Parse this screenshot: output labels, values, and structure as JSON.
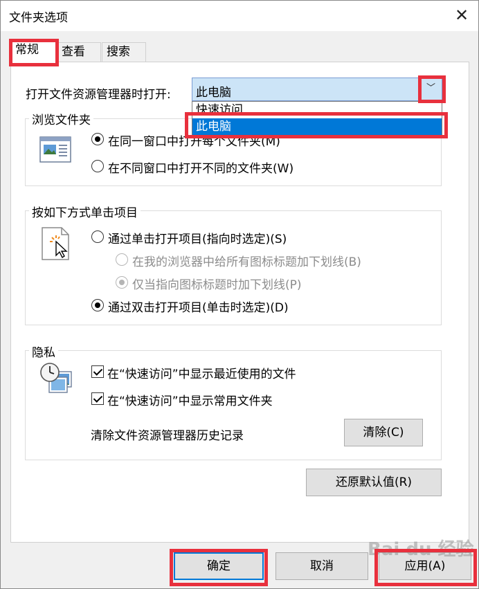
{
  "window": {
    "title": "文件夹选项",
    "close_glyph": "✕"
  },
  "tabs": [
    {
      "label": "常规",
      "active": true
    },
    {
      "label": "查看",
      "active": false
    },
    {
      "label": "搜索",
      "active": false
    }
  ],
  "open_explorer": {
    "label": "打开文件资源管理器时打开:",
    "selected_value": "此电脑",
    "arrow_glyph": "﹀",
    "options": [
      "快速访问",
      "此电脑"
    ],
    "highlighted_option": "此电脑"
  },
  "browse_folders": {
    "title": "浏览文件夹",
    "icon": "folder-window-icon",
    "options": [
      {
        "label": "在同一窗口中打开每个文件夹(M)",
        "visible_label": "在同一窗口中打开每个文件夹(M)",
        "checked": true
      },
      {
        "label": "在不同窗口中打开不同的文件夹(W)",
        "checked": false
      }
    ]
  },
  "click_items": {
    "title": "按如下方式单击项目",
    "icon": "pointer-click-icon",
    "single_click": {
      "label": "通过单击打开项目(指向时选定)(S)",
      "checked": false
    },
    "underline_all": {
      "label": "在我的浏览器中给所有图标标题加下划线(B)",
      "checked": false,
      "disabled": true
    },
    "underline_hover": {
      "label": "仅当指向图标标题时加下划线(P)",
      "checked": true,
      "disabled": true
    },
    "double_click": {
      "label": "通过双击打开项目(单击时选定)(D)",
      "checked": true
    }
  },
  "privacy": {
    "title": "隐私",
    "icon": "history-clock-icon",
    "show_recent_files": {
      "label": "在“快速访问”中显示最近使用的文件",
      "checked": true
    },
    "show_frequent_folders": {
      "label": "在“快速访问”中显示常用文件夹",
      "checked": true
    },
    "clear_label": "清除文件资源管理器历史记录",
    "clear_button": "清除(C)"
  },
  "restore_defaults_button": "还原默认值(R)",
  "footer": {
    "ok": "确定",
    "cancel": "取消",
    "apply": "应用(A)"
  },
  "watermark": "Bai du 经验",
  "colors": {
    "highlight_red": "#e8303d",
    "selection_blue": "#0078d7",
    "combo_fill": "#cce4f7"
  }
}
